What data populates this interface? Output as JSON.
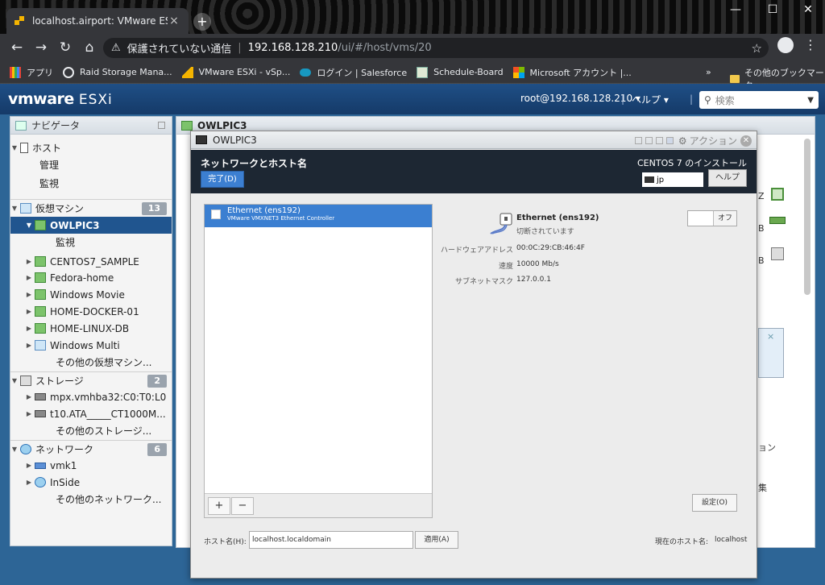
{
  "browser": {
    "tab_title": "localhost.airport: VMware ESXi",
    "tab_close": "×",
    "new_tab": "+",
    "window_controls": [
      "—",
      "☐",
      "✕"
    ],
    "address": {
      "security_warning": "保護されていない通信",
      "host": "192.168.128.210",
      "path": "/ui/#/host/vms/20"
    },
    "bookmarks": [
      "アプリ",
      "Raid Storage Mana...",
      "VMware ESXi - vSp...",
      "ログイン | Salesforce",
      "Schedule-Board",
      "Microsoft アカウント |..."
    ],
    "bookmarks_more": "»",
    "other_bookmarks": "その他のブックマーク"
  },
  "esxi_header": {
    "logo_vm": "vmware",
    "logo_product": "ESXi",
    "user": "root@192.168.128.210 ▾",
    "help": "ヘルプ ▾",
    "search_placeholder": "検索"
  },
  "navigator": {
    "title": "ナビゲータ",
    "host_label": "ホスト",
    "host_items": [
      "管理",
      "監視"
    ],
    "vms_label": "仮想マシン",
    "vms_count": "13",
    "selected_vm": "OWLPIC3",
    "selected_vm_sub": "監視",
    "vms": [
      "CENTOS7_SAMPLE",
      "Fedora-home",
      "Windows Movie",
      "HOME-DOCKER-01",
      "HOME-LINUX-DB",
      "Windows Multi"
    ],
    "vms_more": "その他の仮想マシン...",
    "storage_label": "ストレージ",
    "storage_count": "2",
    "storage": [
      "mpx.vmhba32:C0:T0:L0",
      "t10.ATA_____CT1000M..."
    ],
    "storage_more": "その他のストレージ...",
    "network_label": "ネットワーク",
    "network_count": "6",
    "networks": [
      "vmk1",
      "InSide"
    ],
    "network_more": "その他のネットワーク..."
  },
  "content": {
    "panel_title": "OWLPIC3"
  },
  "console": {
    "title": "OWLPIC3",
    "actions_label": "アクション",
    "screen_title": "ネットワークとホスト名",
    "done_button": "完了(D)",
    "installer_title": "CENTOS 7 のインストール",
    "keyboard": "jp",
    "help_button": "ヘルプ",
    "interface_name": "Ethernet (ens192)",
    "interface_desc": "VMware VMXNET3 Ethernet Controller",
    "detail_name": "Ethernet (ens192)",
    "detail_status": "切断されています",
    "toggle_label": "オフ",
    "fields": [
      {
        "label": "ハードウェアアドレス",
        "value": "00:0C:29:CB:46:4F"
      },
      {
        "label": "速度",
        "value": "10000 Mb/s"
      },
      {
        "label": "サブネットマスク",
        "value": "127.0.0.1"
      }
    ],
    "add_button": "+",
    "remove_button": "−",
    "configure_button": "設定(O)",
    "hostname_label": "ホスト名(H):",
    "hostname_value": "localhost.localdomain",
    "apply_button": "適用(A)",
    "current_hostname_label": "現在のホスト名:",
    "current_hostname_value": "localhost"
  },
  "side_fragments": [
    "Z",
    "B",
    "B",
    "ョン",
    "集"
  ],
  "colors": {
    "esxi_header": "#1f4f86",
    "selected_nav": "#20558f",
    "installer_bar": "#1d2733",
    "accent_blue": "#3b7fd1"
  }
}
